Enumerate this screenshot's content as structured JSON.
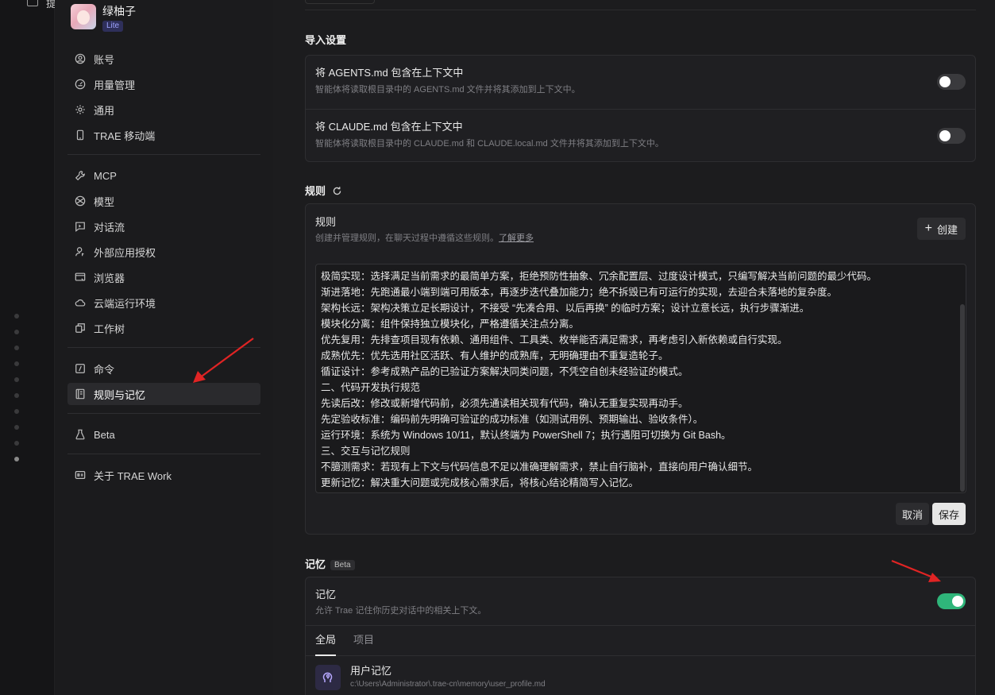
{
  "left_rail": {
    "top_label": "提"
  },
  "profile": {
    "name": "绿柚子",
    "plan": "Lite"
  },
  "nav": {
    "group1": [
      {
        "label": "账号",
        "icon": "user-circle-icon"
      },
      {
        "label": "用量管理",
        "icon": "gauge-icon"
      },
      {
        "label": "通用",
        "icon": "gear-icon"
      },
      {
        "label": "TRAE 移动端",
        "icon": "phone-icon"
      }
    ],
    "group2": [
      {
        "label": "MCP",
        "icon": "wrench-icon"
      },
      {
        "label": "模型",
        "icon": "model-icon"
      },
      {
        "label": "对话流",
        "icon": "chat-flow-icon"
      },
      {
        "label": "外部应用授权",
        "icon": "user-key-icon"
      },
      {
        "label": "浏览器",
        "icon": "browser-icon"
      },
      {
        "label": "云端运行环境",
        "icon": "cloud-icon"
      },
      {
        "label": "工作树",
        "icon": "worktree-icon"
      }
    ],
    "group3": [
      {
        "label": "命令",
        "icon": "command-icon"
      },
      {
        "label": "规则与记忆",
        "icon": "rules-book-icon",
        "active": true
      }
    ],
    "group4": [
      {
        "label": "Beta",
        "icon": "flask-icon"
      }
    ],
    "group5": [
      {
        "label": "关于 TRAE Work",
        "icon": "info-card-icon"
      }
    ]
  },
  "import_settings": {
    "title": "导入设置",
    "rows": [
      {
        "title": "将 AGENTS.md 包含在上下文中",
        "desc": "智能体将读取根目录中的 AGENTS.md 文件并将其添加到上下文中。",
        "enabled": false
      },
      {
        "title": "将 CLAUDE.md 包含在上下文中",
        "desc": "智能体将读取根目录中的 CLAUDE.md 和 CLAUDE.local.md 文件并将其添加到上下文中。",
        "enabled": false
      }
    ]
  },
  "rules": {
    "section_title": "规则",
    "card_title": "规则",
    "card_desc": "创建并管理规则，在聊天过程中遵循这些规则。",
    "learn_more": "了解更多",
    "create_label": "创建",
    "content_lines": [
      "极简实现：选择满足当前需求的最简单方案，拒绝预防性抽象、冗余配置层、过度设计模式，只编写解决当前问题的最少代码。",
      "渐进落地：先跑通最小端到端可用版本，再逐步迭代叠加能力；绝不拆毁已有可运行的实现，去迎合未落地的复杂度。",
      "架构长远：架构决策立足长期设计，不接受 “先凑合用、以后再换” 的临时方案；设计立意长远，执行步骤渐进。",
      "模块化分离：组件保持独立模块化，严格遵循关注点分离。",
      "优先复用：先排查项目现有依赖、通用组件、工具类、枚举能否满足需求，再考虑引入新依赖或自行实现。",
      "成熟优先：优先选用社区活跃、有人维护的成熟库，无明确理由不重复造轮子。",
      "循证设计：参考成熟产品的已验证方案解决同类问题，不凭空自创未经验证的模式。",
      "二、代码开发执行规范",
      "先读后改：修改或新增代码前，必须先通读相关现有代码，确认无重复实现再动手。",
      "先定验收标准：编码前先明确可验证的成功标准（如测试用例、预期输出、验收条件）。",
      "运行环境：系统为 Windows 10/11，默认终端为 PowerShell 7；执行遇阻可切换为 Git Bash。",
      "三、交互与记忆规则",
      "不臆测需求：若现有上下文与代码信息不足以准确理解需求，禁止自行脑补，直接向用户确认细节。",
      "更新记忆：解决重大问题或完成核心需求后，将核心结论精简写入记忆。"
    ],
    "cancel_label": "取消",
    "save_label": "保存"
  },
  "memory": {
    "section_title": "记忆",
    "badge": "Beta",
    "card_title": "记忆",
    "card_desc": "允许 Trae 记住你历史对话中的相关上下文。",
    "enabled": true,
    "tabs": [
      "全局",
      "项目"
    ],
    "item": {
      "title": "用户记忆",
      "path": "c:\\Users\\Administrator\\.trae-cn\\memory\\user_profile.md"
    }
  },
  "colors": {
    "accent_green": "#2fb57a",
    "annotation_red": "#e02424"
  }
}
